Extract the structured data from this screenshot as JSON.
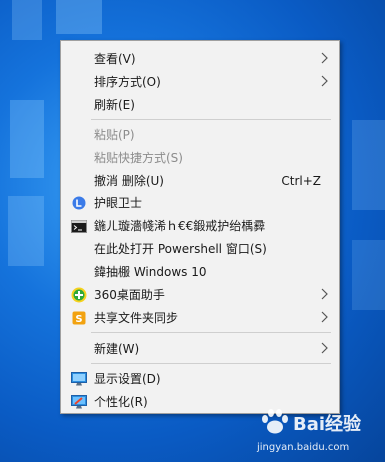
{
  "menu": {
    "view": "查看(V)",
    "sort": "排序方式(O)",
    "refresh": "刷新(E)",
    "paste": "粘贴(P)",
    "paste_shortcut": "粘贴快捷方式(S)",
    "undo": "撤消 删除(U)",
    "undo_shortcut": "Ctrl+Z",
    "eye_guard": "护眼卫士",
    "garbled_item": "鍦ㄦ璇濇帴浠ｈ€€鍛戒护绐楀彛",
    "powershell": "在此处打开 Powershell 窗口(S)",
    "garbled_windows": "鍏抽棴 Windows 10",
    "desktop_assistant": "360桌面助手",
    "share_sync": "共享文件夹同步",
    "new": "新建(W)",
    "display": "显示设置(D)",
    "personalize": "个性化(R)"
  },
  "watermark": {
    "title": "Bai经验",
    "url": "jingyan.baidu.com"
  },
  "colors": {
    "eye_icon": "#3b7be8",
    "assistant_icon": "#2ea83a",
    "share_icon": "#f2a20f"
  },
  "icons": {
    "eye_guard": "circle-l-icon",
    "terminal": "terminal-icon",
    "desktop_assistant": "360-icon",
    "share_sync": "s-badge-icon",
    "display": "monitor-icon",
    "personalize": "paint-icon"
  }
}
